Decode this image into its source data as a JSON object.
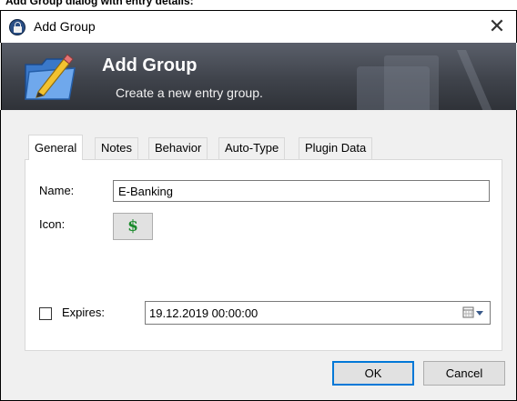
{
  "window": {
    "top_caption": "Add Group dialog with entry details:",
    "title": "Add Group",
    "close_glyph": "✕"
  },
  "banner": {
    "title": "Add Group",
    "subtitle": "Create a new entry group."
  },
  "tabs": [
    {
      "label": "General",
      "active": true
    },
    {
      "label": "Notes",
      "active": false
    },
    {
      "label": "Behavior",
      "active": false
    },
    {
      "label": "Auto-Type",
      "active": false
    },
    {
      "label": "Plugin Data",
      "active": false
    }
  ],
  "general": {
    "name_label": "Name:",
    "name_value": "E-Banking",
    "icon_label": "Icon:",
    "icon_glyph": "$",
    "icon_name": "dollar-icon",
    "expires_label": "Expires:",
    "expires_checked": false,
    "expires_value": "19.12.2019 00:00:00"
  },
  "buttons": {
    "ok": "OK",
    "cancel": "Cancel"
  },
  "colors": {
    "banner_top": "#5a5f6a",
    "banner_bottom": "#2f3238",
    "icon_green": "#1a8a2c",
    "focus_blue": "#0078d7"
  }
}
